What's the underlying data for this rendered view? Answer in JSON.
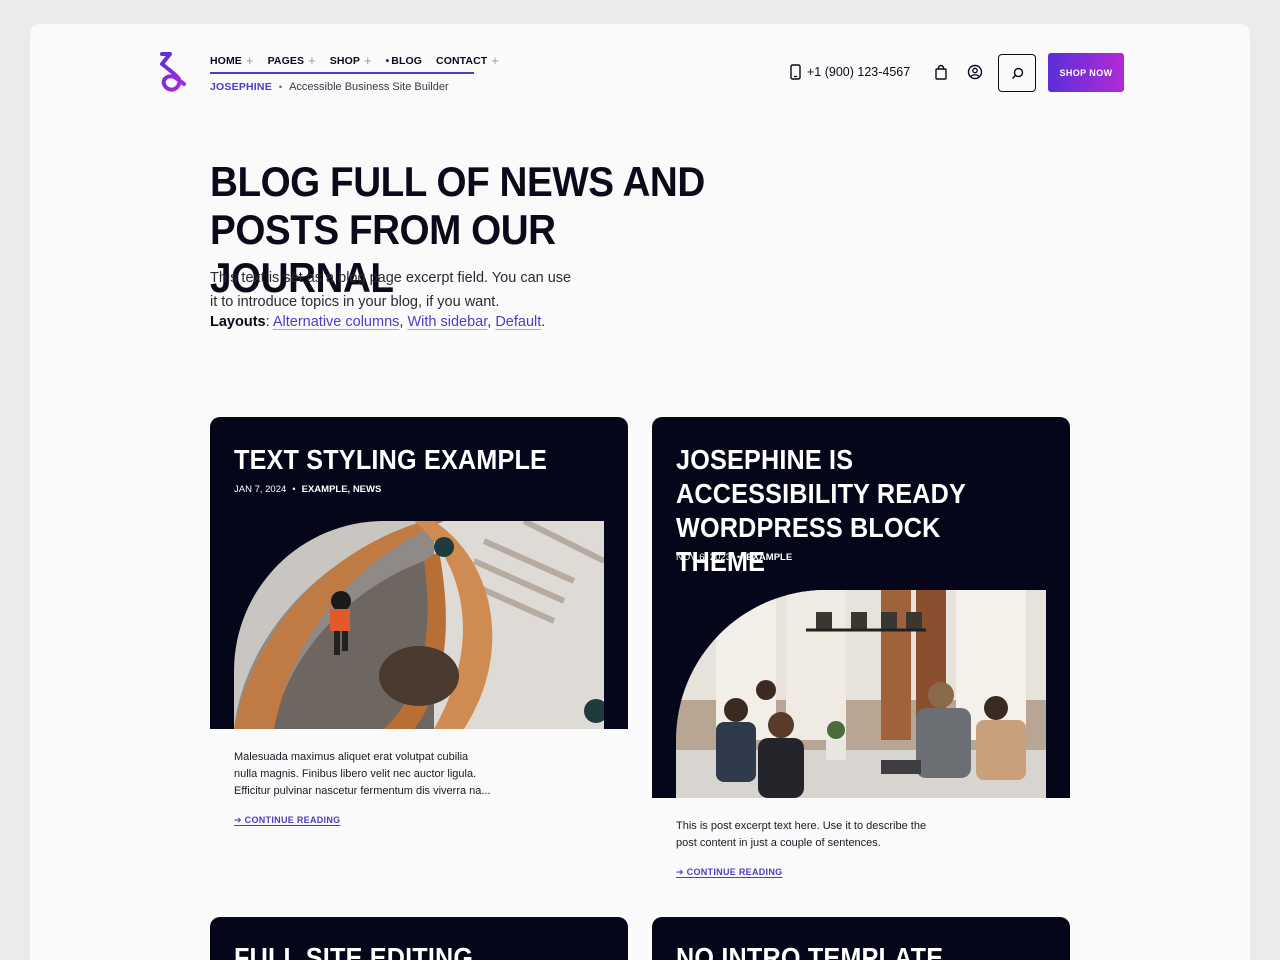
{
  "header": {
    "nav": [
      {
        "label": "HOME",
        "has_sub": true
      },
      {
        "label": "PAGES",
        "has_sub": true
      },
      {
        "label": "SHOP",
        "has_sub": true
      },
      {
        "label": "BLOG",
        "has_sub": false,
        "current": true
      },
      {
        "label": "CONTACT",
        "has_sub": true
      }
    ],
    "brand": "JOSEPHINE",
    "tagline": "Accessible Business Site Builder",
    "phone": "+1 (900) 123-4567",
    "shop_button": "SHOP NOW",
    "icons": [
      "phone-icon",
      "bag-icon",
      "user-icon",
      "search-icon"
    ]
  },
  "hero": {
    "title_line1": "BLOG FULL OF NEWS AND",
    "title_line2": "POSTS FROM OUR JOURNAL",
    "excerpt_line1": "This text is set as a blog page excerpt field. You can use",
    "excerpt_line2": "it to introduce topics in your blog, if you want.",
    "layouts_label": "Layouts",
    "layouts": [
      "Alternative columns",
      "With sidebar",
      "Default"
    ]
  },
  "posts": [
    {
      "title": "TEXT STYLING EXAMPLE",
      "date": "JAN 7, 2024",
      "tags": "EXAMPLE, NEWS",
      "excerpt_line1": "Malesuada maximus aliquet erat volutpat cubilia",
      "excerpt_line2": "nulla magnis. Finibus libero velit nec auctor ligula.",
      "excerpt_line3": "Efficitur pulvinar nascetur fermentum dis viverra na...",
      "continue": "➔ CONTINUE READING"
    },
    {
      "title_line1": "JOSEPHINE IS",
      "title_line2": "ACCESSIBILITY READY",
      "title_line3": "WORDPRESS BLOCK THEME",
      "date": "NOV 6, 2023",
      "tags": "EXAMPLE",
      "excerpt_line1": "This is post excerpt text here. Use it to describe the",
      "excerpt_line2": "post content in just a couple of sentences.",
      "continue": "➔ CONTINUE READING"
    },
    {
      "title": "FULL SITE EDITING"
    },
    {
      "title": "NO INTRO TEMPLATE"
    }
  ],
  "colors": {
    "accent": "#4a3fc4",
    "card_bg": "#06061a",
    "gradient_start": "#5b2fd8",
    "gradient_end": "#b22ad8"
  }
}
